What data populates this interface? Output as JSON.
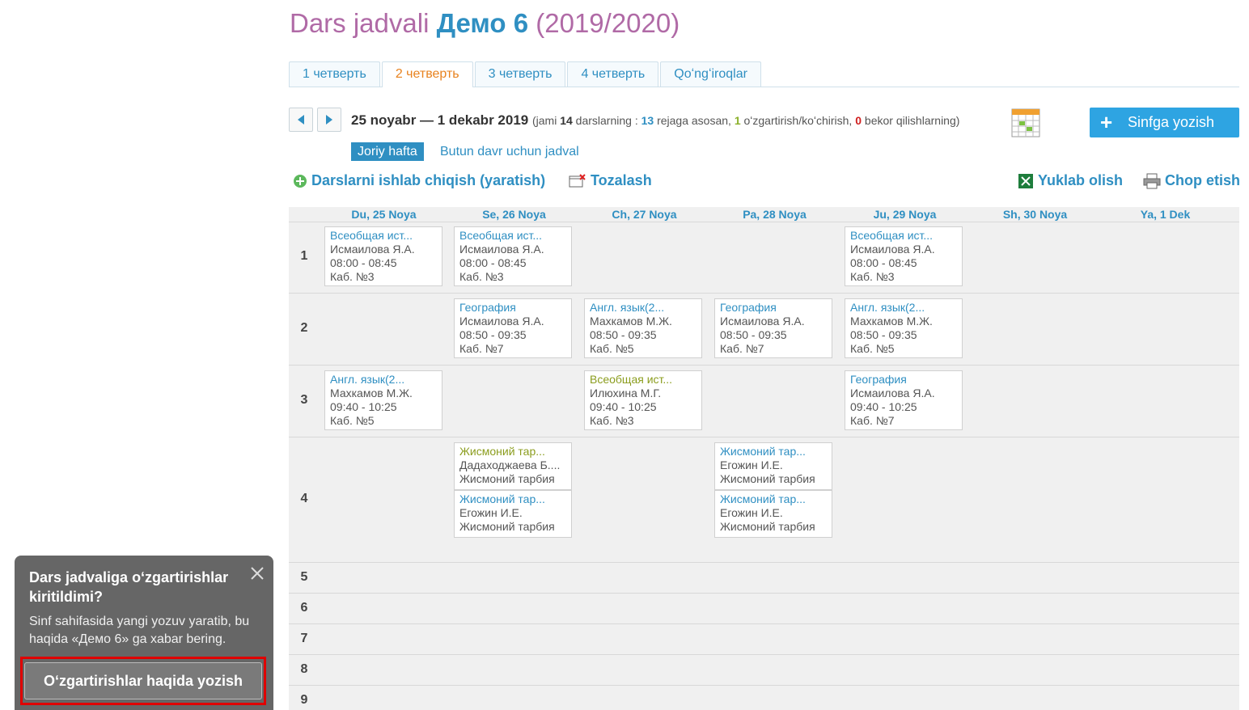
{
  "header": {
    "title_prefix": "Dars jadvali",
    "class_name": "Демо 6",
    "year": "(2019/2020)"
  },
  "tabs": [
    {
      "label": "1 четверть",
      "active": false
    },
    {
      "label": "2 четверть",
      "active": true
    },
    {
      "label": "3 четверть",
      "active": false
    },
    {
      "label": "4 четверть",
      "active": false
    },
    {
      "label": "Qoʻngʻiroqlar",
      "active": false
    }
  ],
  "week": {
    "range": "25 noyabr — 1 dekabr 2019",
    "jami": "(jami",
    "total": "14",
    "lessons_word": "darslarning :",
    "planned": "13",
    "planned_label": "rejaga asosan,",
    "changed": "1",
    "changed_label": "oʻzgartirish/koʻchirish,",
    "cancelled": "0",
    "cancelled_label": "bekor qilishlarning)",
    "enroll_button": "Sinfga yozish",
    "enroll_plus": "+"
  },
  "view": {
    "current_week": "Joriy hafta",
    "all_period": "Butun davr uchun jadval"
  },
  "actions": {
    "generate": "Darslarni ishlab chiqish (yaratish)",
    "clear": "Tozalash",
    "download": "Yuklab olish",
    "print": "Chop etish"
  },
  "days": [
    "Du, 25 Noya",
    "Se, 26 Noya",
    "Ch, 27 Noya",
    "Pa, 28 Noya",
    "Ju, 29 Noya",
    "Sh, 30 Noya",
    "Ya, 1 Dek"
  ],
  "periods": [
    "1",
    "2",
    "3",
    "4",
    "5",
    "6",
    "7",
    "8",
    "9"
  ],
  "lessons": [
    {
      "subject": "Всеобщая ист...",
      "teacher": "Исмаилова Я.А.",
      "time": "08:00 - 08:45",
      "room": "Каб. №3"
    },
    {
      "subject": "Всеобщая ист...",
      "teacher": "Исмаилова Я.А.",
      "time": "08:00 - 08:45",
      "room": "Каб. №3"
    },
    {
      "subject": "Всеобщая ист...",
      "teacher": "Исмаилова Я.А.",
      "time": "08:00 - 08:45",
      "room": "Каб. №3"
    },
    {
      "subject": "География",
      "teacher": "Исмаилова Я.А.",
      "time": "08:50 - 09:35",
      "room": "Каб. №7"
    },
    {
      "subject": "Англ. язык(2...",
      "teacher": "Махкамов М.Ж.",
      "time": "08:50 - 09:35",
      "room": "Каб. №5"
    },
    {
      "subject": "География",
      "teacher": "Исмаилова Я.А.",
      "time": "08:50 - 09:35",
      "room": "Каб. №7"
    },
    {
      "subject": "Англ. язык(2...",
      "teacher": "Махкамов М.Ж.",
      "time": "08:50 - 09:35",
      "room": "Каб. №5"
    },
    {
      "subject": "Англ. язык(2...",
      "teacher": "Махкамов М.Ж.",
      "time": "09:40 - 10:25",
      "room": "Каб. №5"
    },
    {
      "subject": "Всеобщая ист...",
      "teacher": "Илюхина М.Г.",
      "time": "09:40 - 10:25",
      "room": "Каб. №3"
    },
    {
      "subject": "География",
      "teacher": "Исмаилова Я.А.",
      "time": "09:40 - 10:25",
      "room": "Каб. №7"
    },
    {
      "subject": "Жисмоний тар...",
      "teacher": "Дадаходжаева Б....",
      "room": "Жисмоний тарбия"
    },
    {
      "subject": "Жисмоний тар...",
      "teacher": "Егожин И.Е.",
      "room": "Жисмоний тарбия"
    },
    {
      "subject": "Жисмоний тар...",
      "teacher": "Егожин И.Е.",
      "room": "Жисмоний тарбия"
    },
    {
      "subject": "Жисмоний тар...",
      "teacher": "Егожин И.Е.",
      "room": "Жисмоний тарбия"
    }
  ],
  "popup": {
    "title": "Dars jadvaliga oʻzgartirishlar kiritildimi?",
    "text": "Sinf sahifasida yangi yozuv yaratib, bu haqida «Демо 6» ga xabar bering.",
    "button": "Oʻzgartirishlar haqida yozish"
  },
  "colors": {
    "accent": "#2f8fc2",
    "title": "#b06aa6",
    "active_tab": "#e8821e",
    "changed_subject": "#8b9d1e",
    "enroll_button": "#2ea4e2",
    "highlight": "#e00000"
  },
  "icons": [
    "prev-week-icon",
    "next-week-icon",
    "calendar-icon",
    "add-circle-icon",
    "clear-icon",
    "excel-icon",
    "printer-icon",
    "close-icon"
  ]
}
